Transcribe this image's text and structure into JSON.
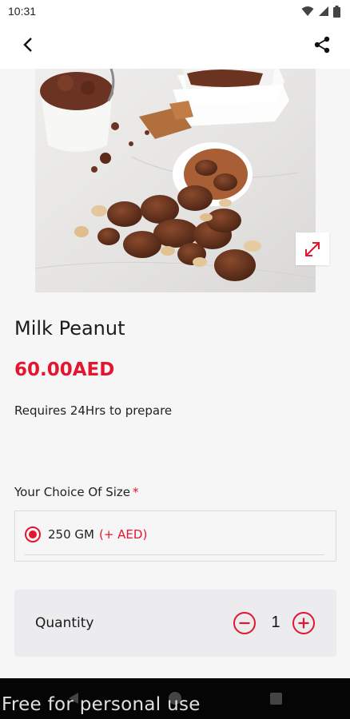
{
  "status_bar": {
    "time": "10:31",
    "icons": [
      "wifi-icon",
      "signal-icon",
      "battery-icon"
    ]
  },
  "header": {
    "back_icon": "chevron-left-icon",
    "share_icon": "share-icon"
  },
  "product": {
    "image_icon": "product-photo",
    "expand_icon": "expand-icon",
    "name": "Milk Peanut",
    "price": "60.00AED",
    "prep_note": "Requires 24Hrs to prepare"
  },
  "size": {
    "label": "Your Choice Of Size",
    "required_mark": "*",
    "selected": {
      "name": "250 GM",
      "extra": "(+ AED)"
    }
  },
  "quantity": {
    "label": "Quantity",
    "value": "1",
    "minus_icon": "minus-circle-icon",
    "plus_icon": "plus-circle-icon"
  },
  "watermark": "Free for personal use",
  "colors": {
    "accent": "#e3162f",
    "background": "#f6f6f7",
    "card": "#ececee",
    "nav_bar": "#050505"
  }
}
